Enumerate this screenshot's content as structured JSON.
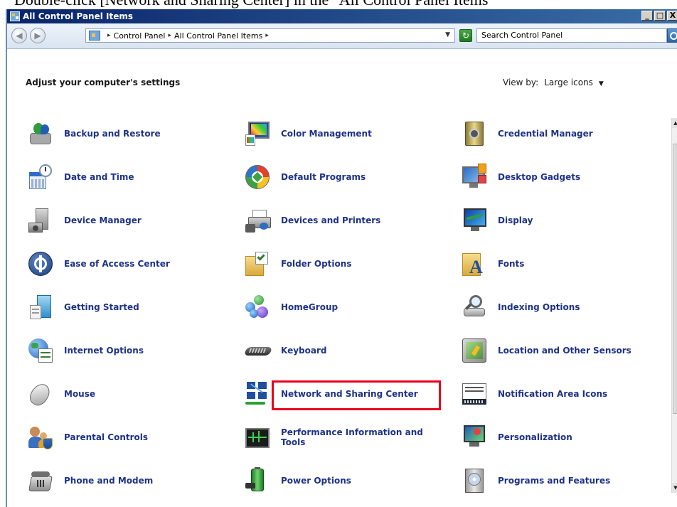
{
  "instruction": "Double-click [Network and Sharing Center] in the \"All Control Panel Items\"",
  "window": {
    "title": "All Control Panel Items",
    "controls": [
      "_",
      "□",
      "X"
    ]
  },
  "address": {
    "crumbs": [
      "Control Panel",
      "All Control Panel Items"
    ],
    "search_placeholder": "Search Control Panel"
  },
  "header": {
    "title": "Adjust your computer's settings",
    "view_by_label": "View by:",
    "view_by_value": "Large icons"
  },
  "items": [
    {
      "label": "Backup and Restore",
      "icon": "backup-restore-icon"
    },
    {
      "label": "Color Management",
      "icon": "color-management-icon"
    },
    {
      "label": "Credential Manager",
      "icon": "credential-manager-icon"
    },
    {
      "label": "Date and Time",
      "icon": "date-time-icon"
    },
    {
      "label": "Default Programs",
      "icon": "default-programs-icon"
    },
    {
      "label": "Desktop Gadgets",
      "icon": "desktop-gadgets-icon"
    },
    {
      "label": "Device Manager",
      "icon": "device-manager-icon"
    },
    {
      "label": "Devices and Printers",
      "icon": "devices-printers-icon"
    },
    {
      "label": "Display",
      "icon": "display-icon"
    },
    {
      "label": "Ease of Access Center",
      "icon": "ease-of-access-icon"
    },
    {
      "label": "Folder Options",
      "icon": "folder-options-icon"
    },
    {
      "label": "Fonts",
      "icon": "fonts-icon"
    },
    {
      "label": "Getting Started",
      "icon": "getting-started-icon"
    },
    {
      "label": "HomeGroup",
      "icon": "homegroup-icon"
    },
    {
      "label": "Indexing Options",
      "icon": "indexing-options-icon"
    },
    {
      "label": "Internet Options",
      "icon": "internet-options-icon"
    },
    {
      "label": "Keyboard",
      "icon": "keyboard-icon"
    },
    {
      "label": "Location and Other Sensors",
      "icon": "location-sensors-icon"
    },
    {
      "label": "Mouse",
      "icon": "mouse-icon"
    },
    {
      "label": "Network and Sharing Center",
      "icon": "network-sharing-icon",
      "highlighted": true
    },
    {
      "label": "Notification Area Icons",
      "icon": "notification-area-icon"
    },
    {
      "label": "Parental Controls",
      "icon": "parental-controls-icon"
    },
    {
      "label": "Performance Information and Tools",
      "icon": "performance-info-icon"
    },
    {
      "label": "Personalization",
      "icon": "personalization-icon"
    },
    {
      "label": "Phone and Modem",
      "icon": "phone-modem-icon"
    },
    {
      "label": "Power Options",
      "icon": "power-options-icon"
    },
    {
      "label": "Programs and Features",
      "icon": "programs-features-icon"
    }
  ],
  "colors": {
    "link_text": "#1e3287",
    "highlight_box": "#e8001c",
    "titlebar": "#0a246a"
  }
}
